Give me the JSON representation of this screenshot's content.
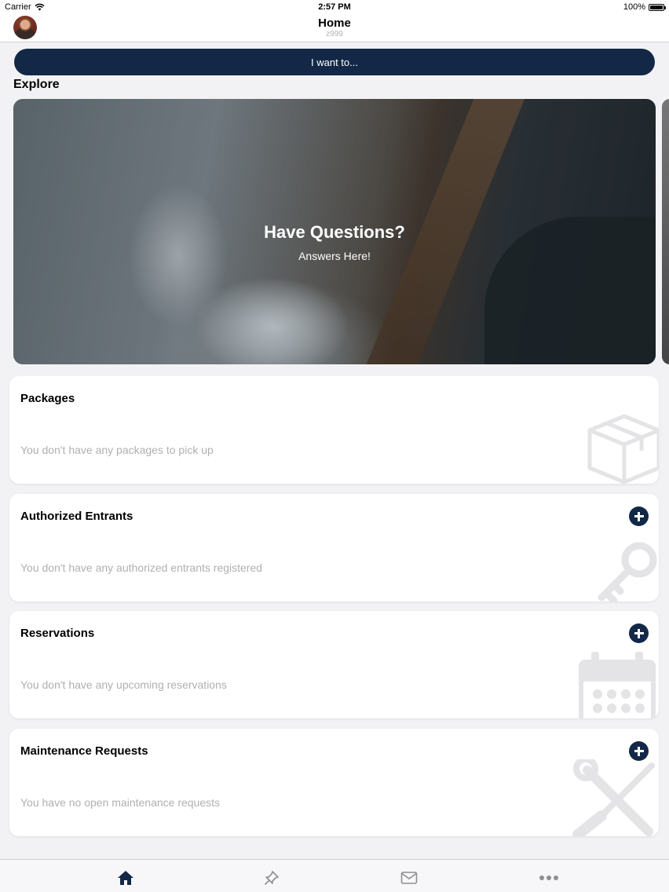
{
  "status_bar": {
    "carrier": "Carrier",
    "time": "2:57 PM",
    "battery": "100%"
  },
  "header": {
    "title": "Home",
    "subtitle": "z999"
  },
  "action_button": {
    "label": "I want to..."
  },
  "explore": {
    "heading": "Explore",
    "hero": {
      "title": "Have Questions?",
      "subtitle": "Answers Here!"
    }
  },
  "cards": {
    "packages": {
      "title": "Packages",
      "empty_text": "You don't have any packages to pick up",
      "icon": "package-box-icon"
    },
    "entrants": {
      "title": "Authorized Entrants",
      "empty_text": "You don't have any authorized entrants registered",
      "icon": "key-icon"
    },
    "reservations": {
      "title": "Reservations",
      "empty_text": "You don't have any upcoming reservations",
      "icon": "calendar-icon"
    },
    "maintenance": {
      "title": "Maintenance Requests",
      "empty_text": "You have no open maintenance requests",
      "icon": "tools-icon"
    }
  },
  "tab_bar": {
    "tabs": [
      {
        "name": "home",
        "icon": "home-icon",
        "active": true
      },
      {
        "name": "pin",
        "icon": "pin-icon",
        "active": false
      },
      {
        "name": "messages",
        "icon": "envelope-icon",
        "active": false
      },
      {
        "name": "more",
        "icon": "more-dots-icon",
        "active": false
      }
    ]
  },
  "colors": {
    "accent": "#132847",
    "background": "#f2f2f4",
    "muted_text": "#b0b0b4",
    "inactive_tab": "#8e8e93"
  }
}
